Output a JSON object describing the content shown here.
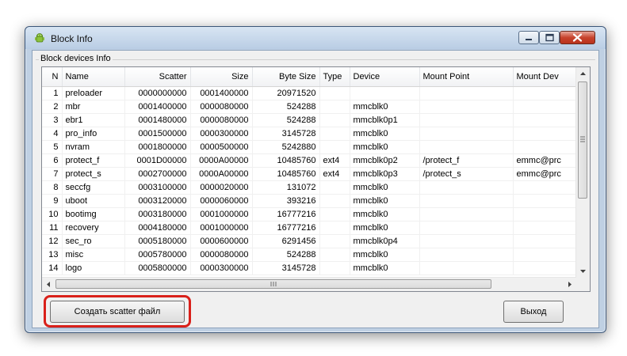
{
  "window": {
    "title": "Block Info"
  },
  "group": {
    "label": "Block devices Info"
  },
  "columns": [
    "N",
    "Name",
    "Scatter",
    "Size",
    "Byte Size",
    "Type",
    "Device",
    "Mount Point",
    "Mount Dev"
  ],
  "rows": [
    [
      "1",
      "preloader",
      "0000000000",
      "0001400000",
      "20971520",
      "",
      "",
      "",
      ""
    ],
    [
      "2",
      "mbr",
      "0001400000",
      "0000080000",
      "524288",
      "",
      "mmcblk0",
      "",
      ""
    ],
    [
      "3",
      "ebr1",
      "0001480000",
      "0000080000",
      "524288",
      "",
      "mmcblk0p1",
      "",
      ""
    ],
    [
      "4",
      "pro_info",
      "0001500000",
      "0000300000",
      "3145728",
      "",
      "mmcblk0",
      "",
      ""
    ],
    [
      "5",
      "nvram",
      "0001800000",
      "0000500000",
      "5242880",
      "",
      "mmcblk0",
      "",
      ""
    ],
    [
      "6",
      "protect_f",
      "0001D00000",
      "0000A00000",
      "10485760",
      "ext4",
      "mmcblk0p2",
      "/protect_f",
      "emmc@prc"
    ],
    [
      "7",
      "protect_s",
      "0002700000",
      "0000A00000",
      "10485760",
      "ext4",
      "mmcblk0p3",
      "/protect_s",
      "emmc@prc"
    ],
    [
      "8",
      "seccfg",
      "0003100000",
      "0000020000",
      "131072",
      "",
      "mmcblk0",
      "",
      ""
    ],
    [
      "9",
      "uboot",
      "0003120000",
      "0000060000",
      "393216",
      "",
      "mmcblk0",
      "",
      ""
    ],
    [
      "10",
      "bootimg",
      "0003180000",
      "0001000000",
      "16777216",
      "",
      "mmcblk0",
      "",
      ""
    ],
    [
      "11",
      "recovery",
      "0004180000",
      "0001000000",
      "16777216",
      "",
      "mmcblk0",
      "",
      ""
    ],
    [
      "12",
      "sec_ro",
      "0005180000",
      "0000600000",
      "6291456",
      "",
      "mmcblk0p4",
      "",
      ""
    ],
    [
      "13",
      "misc",
      "0005780000",
      "0000080000",
      "524288",
      "",
      "mmcblk0",
      "",
      ""
    ],
    [
      "14",
      "logo",
      "0005800000",
      "0000300000",
      "3145728",
      "",
      "mmcblk0",
      "",
      ""
    ]
  ],
  "buttons": {
    "scatter": "Создать scatter файл",
    "exit": "Выход"
  },
  "icons": {
    "app": "android-icon",
    "minimize": "minimize-icon",
    "maximize": "maximize-icon",
    "close": "close-icon"
  },
  "colors": {
    "highlight": "#d9201a",
    "window_frame": "#bfd0e3",
    "close_button": "#c7432d"
  }
}
